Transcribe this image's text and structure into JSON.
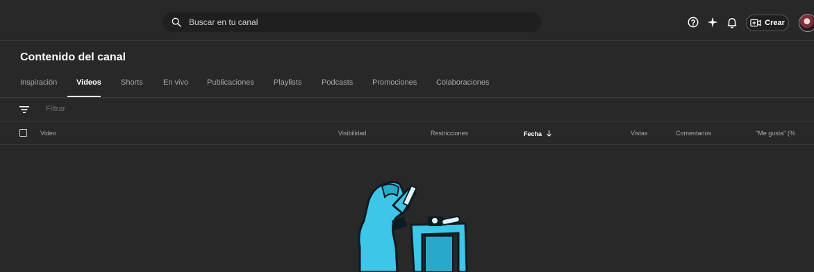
{
  "search": {
    "placeholder": "Buscar en tu canal"
  },
  "header": {
    "create_label": "Crear"
  },
  "page": {
    "title": "Contenido del canal"
  },
  "tabs": [
    {
      "label": "Inspiración"
    },
    {
      "label": "Videos"
    },
    {
      "label": "Shorts"
    },
    {
      "label": "En vivo"
    },
    {
      "label": "Publicaciones"
    },
    {
      "label": "Playlists"
    },
    {
      "label": "Podcasts"
    },
    {
      "label": "Promociones"
    },
    {
      "label": "Colaboraciones"
    }
  ],
  "active_tab": "Videos",
  "filter": {
    "placeholder": "Filtrar"
  },
  "table": {
    "columns": [
      {
        "label": "Video"
      },
      {
        "label": "Visibilidad"
      },
      {
        "label": "Restricciones"
      },
      {
        "label": "Fecha"
      },
      {
        "label": "Vistas"
      },
      {
        "label": "Comentarios"
      },
      {
        "label": "\"Me gusta\" (%"
      }
    ],
    "sorted_by": "Fecha",
    "sort_direction": "descending"
  },
  "icons": {
    "search": "search-icon",
    "help": "help-icon",
    "sparkle": "sparkle-icon",
    "notifications": "bell-icon",
    "create": "video-plus-icon",
    "filter": "filter-icon",
    "sort": "arrow-down-icon"
  },
  "colors": {
    "background": "#282828",
    "search_bg": "#1f1f1f",
    "accent_illustration": "#3ec6e8"
  }
}
